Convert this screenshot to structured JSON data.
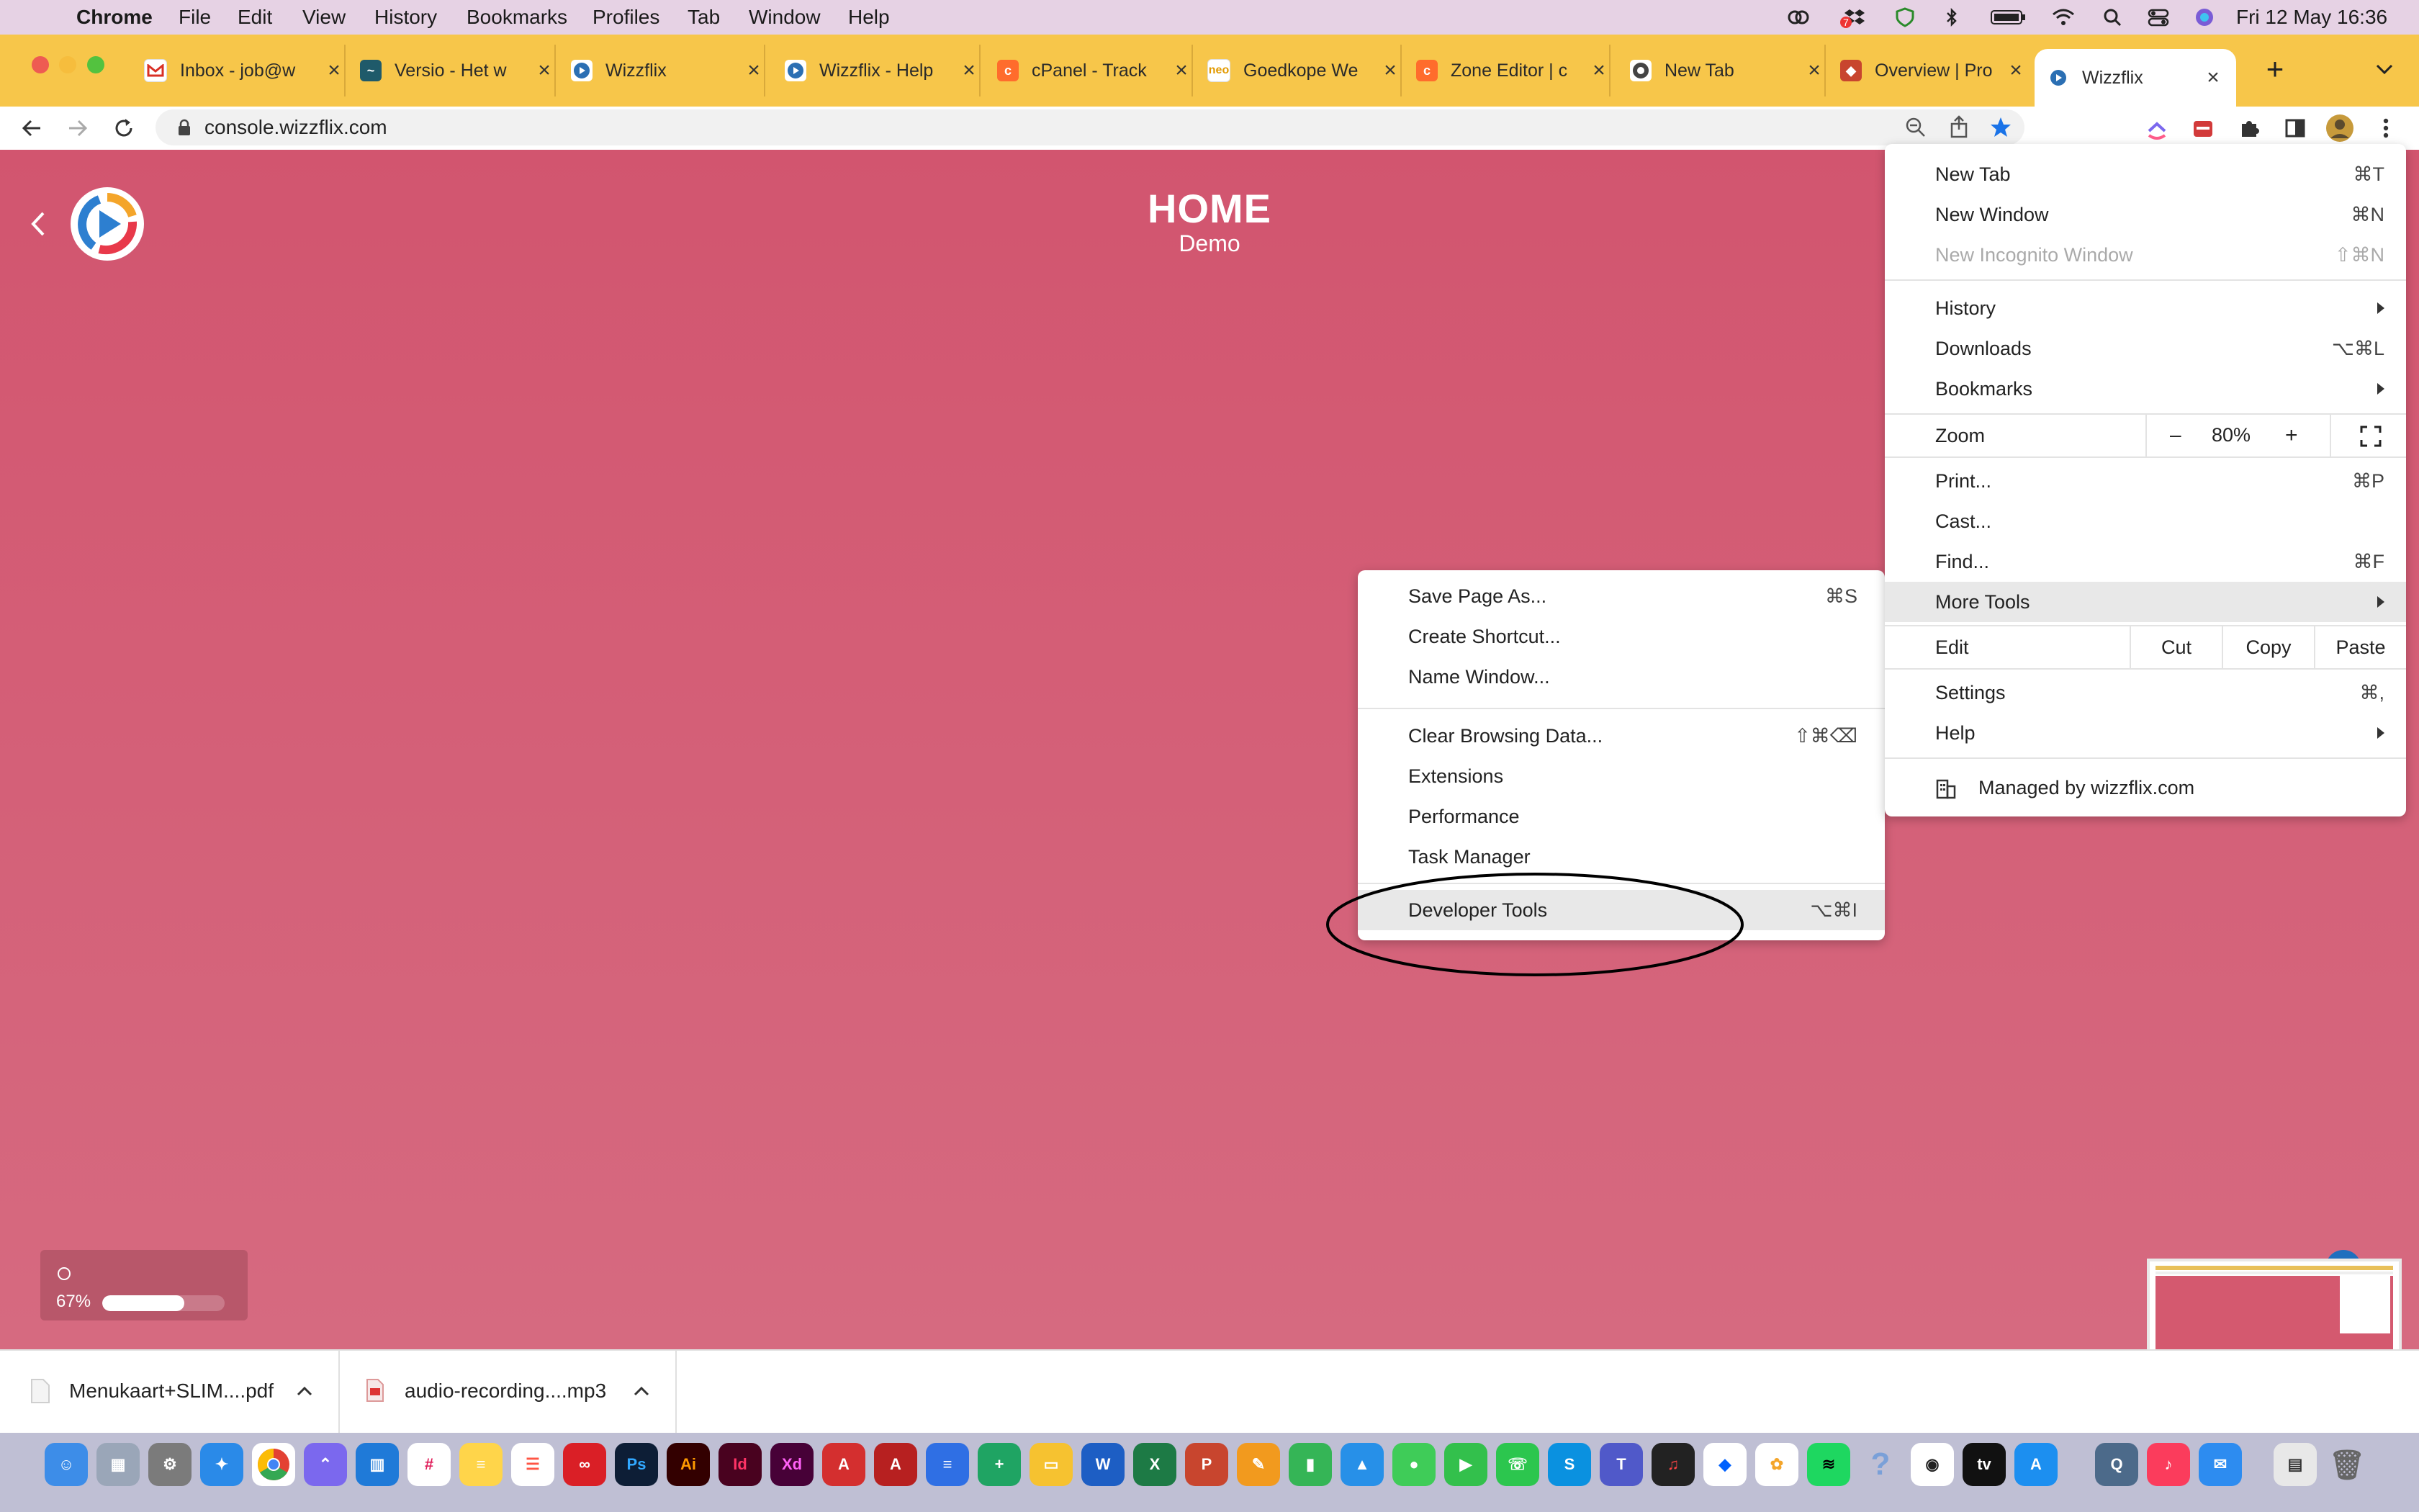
{
  "menubar": {
    "app_name": "Chrome",
    "menus": [
      "File",
      "Edit",
      "View",
      "History",
      "Bookmarks",
      "Profiles",
      "Tab",
      "Window",
      "Help"
    ],
    "datetime": "Fri 12 May  16:36",
    "status_badge": "7"
  },
  "tabs": [
    {
      "title": "Inbox - job@w",
      "icon": "gmail-icon"
    },
    {
      "title": "Versio - Het w",
      "icon": "versio-icon"
    },
    {
      "title": "Wizzflix",
      "icon": "wizzflix-icon"
    },
    {
      "title": "Wizzflix - Help",
      "icon": "wizzflix-icon"
    },
    {
      "title": "cPanel - Track",
      "icon": "cpanel-icon"
    },
    {
      "title": "Goedkope We",
      "icon": "neo-icon",
      "badge": "neo"
    },
    {
      "title": "Zone Editor | c",
      "icon": "cpanel-icon"
    },
    {
      "title": "New Tab",
      "icon": "chrome-icon"
    },
    {
      "title": "Overview | Pro",
      "icon": "overview-icon"
    },
    {
      "title": "Wizzflix",
      "icon": "wizzflix-icon",
      "active": true
    }
  ],
  "url": "console.wizzflix.com",
  "page": {
    "title": "HOME",
    "subtitle": "Demo",
    "progress_label": "67%",
    "progress_value": 0.67
  },
  "chrome_menu": {
    "new_tab": {
      "label": "New Tab",
      "shortcut": "⌘T"
    },
    "new_window": {
      "label": "New Window",
      "shortcut": "⌘N"
    },
    "new_incognito": {
      "label": "New Incognito Window",
      "shortcut": "⇧⌘N"
    },
    "history": "History",
    "downloads": {
      "label": "Downloads",
      "shortcut": "⌥⌘L"
    },
    "bookmarks": "Bookmarks",
    "zoom": {
      "label": "Zoom",
      "minus": "–",
      "value": "80%",
      "plus": "+"
    },
    "print": {
      "label": "Print...",
      "shortcut": "⌘P"
    },
    "cast": "Cast...",
    "find": {
      "label": "Find...",
      "shortcut": "⌘F"
    },
    "more_tools": "More Tools",
    "edit": {
      "label": "Edit",
      "cut": "Cut",
      "copy": "Copy",
      "paste": "Paste"
    },
    "settings": {
      "label": "Settings",
      "shortcut": "⌘,"
    },
    "help": "Help",
    "managed": "Managed by wizzflix.com"
  },
  "more_tools_menu": {
    "save_page": {
      "label": "Save Page As...",
      "shortcut": "⌘S"
    },
    "create_shortcut": "Create Shortcut...",
    "name_window": "Name Window...",
    "clear_data": {
      "label": "Clear Browsing Data...",
      "shortcut": "⇧⌘⌫"
    },
    "extensions": "Extensions",
    "performance": "Performance",
    "task_manager": "Task Manager",
    "developer_tools": {
      "label": "Developer Tools",
      "shortcut": "⌥⌘I"
    }
  },
  "downloads": [
    {
      "name": "Menukaart+SLIM....pdf"
    },
    {
      "name": "audio-recording....mp3"
    }
  ],
  "dock_labels": {
    "ai": "Ai",
    "id": "Id",
    "xd": "Xd",
    "ps": "Ps",
    "tv": "tv",
    "question": "?"
  },
  "colors": {
    "page_bg": "#d4596f",
    "tabstrip_bg": "#f7c64a",
    "menubar_bg": "#e6d2e4",
    "star_accent": "#1a73e8"
  }
}
